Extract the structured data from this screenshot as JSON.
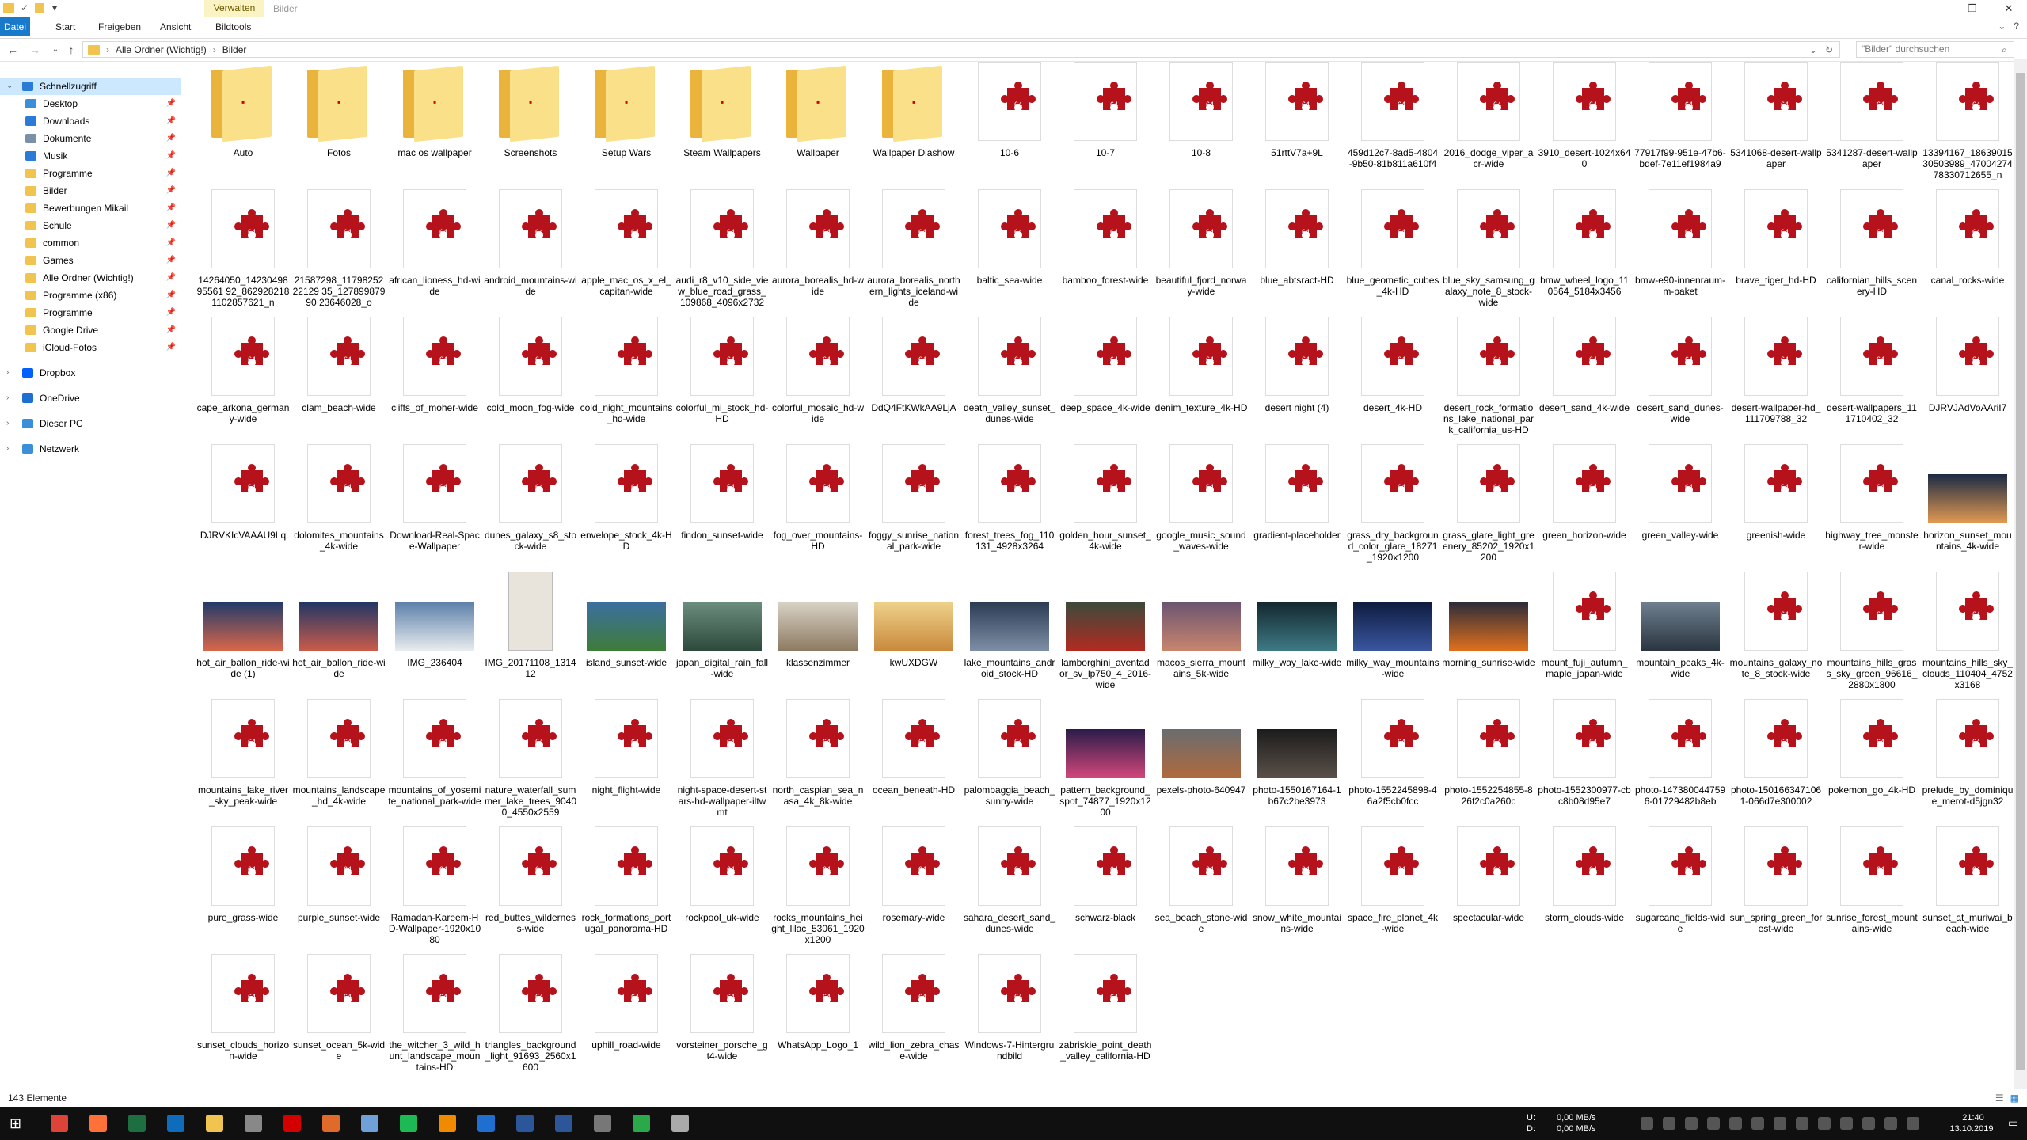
{
  "window": {
    "context_tab": "Verwalten",
    "title": "Bilder"
  },
  "ribbon": {
    "tabs": [
      "Datei",
      "Start",
      "Freigeben",
      "Ansicht",
      "Bildtools"
    ]
  },
  "address": {
    "crumbs": [
      "Alle Ordner (Wichtig!)",
      "Bilder"
    ],
    "search_placeholder": "\"Bilder\" durchsuchen"
  },
  "sidebar": {
    "items": [
      {
        "label": "Schnellzugriff",
        "icon": "star-icon",
        "pinned": false,
        "expand": true
      },
      {
        "label": "Desktop",
        "icon": "desktop-icon",
        "pinned": true
      },
      {
        "label": "Downloads",
        "icon": "download-icon",
        "pinned": true
      },
      {
        "label": "Dokumente",
        "icon": "documents-icon",
        "pinned": true
      },
      {
        "label": "Musik",
        "icon": "music-icon",
        "pinned": true
      },
      {
        "label": "Programme",
        "icon": "folder-icon",
        "pinned": true
      },
      {
        "label": "Bilder",
        "icon": "folder-icon",
        "pinned": true
      },
      {
        "label": "Bewerbungen Mikail",
        "icon": "folder-icon",
        "pinned": true
      },
      {
        "label": "Schule",
        "icon": "folder-icon",
        "pinned": true
      },
      {
        "label": "common",
        "icon": "folder-icon",
        "pinned": true
      },
      {
        "label": "Games",
        "icon": "folder-icon",
        "pinned": true
      },
      {
        "label": "Alle Ordner (Wichtig!)",
        "icon": "folder-icon",
        "pinned": true
      },
      {
        "label": "Programme (x86)",
        "icon": "folder-icon",
        "pinned": true
      },
      {
        "label": "Programme",
        "icon": "folder-icon",
        "pinned": true
      },
      {
        "label": "Google Drive",
        "icon": "folder-icon",
        "pinned": true
      },
      {
        "label": "iCloud-Fotos",
        "icon": "folder-icon",
        "pinned": true
      },
      {
        "label": "Dropbox",
        "icon": "dropbox-icon",
        "pinned": false,
        "expand": true
      },
      {
        "label": "OneDrive",
        "icon": "cloud-icon",
        "pinned": false,
        "expand": true
      },
      {
        "label": "Dieser PC",
        "icon": "pc-icon",
        "pinned": false,
        "expand": true
      },
      {
        "label": "Netzwerk",
        "icon": "network-icon",
        "pinned": false,
        "expand": true
      }
    ]
  },
  "files": [
    {
      "name": "Auto",
      "kind": "folder"
    },
    {
      "name": "Fotos",
      "kind": "folder"
    },
    {
      "name": "mac os wallpaper",
      "kind": "folder"
    },
    {
      "name": "Screenshots",
      "kind": "folder"
    },
    {
      "name": "Setup Wars",
      "kind": "folder"
    },
    {
      "name": "Steam Wallpapers",
      "kind": "folder"
    },
    {
      "name": "Wallpaper",
      "kind": "folder"
    },
    {
      "name": "Wallpaper Diashow",
      "kind": "folder"
    },
    {
      "name": "10-6",
      "kind": "puzzle"
    },
    {
      "name": "10-7",
      "kind": "puzzle"
    },
    {
      "name": "10-8",
      "kind": "puzzle"
    },
    {
      "name": "51rttV7a+9L",
      "kind": "puzzle"
    },
    {
      "name": "459d12c7-8ad5-4804-9b50-81b811a610f4",
      "kind": "puzzle"
    },
    {
      "name": "2016_dodge_viper_acr-wide",
      "kind": "puzzle"
    },
    {
      "name": "3910_desert-1024x640",
      "kind": "puzzle"
    },
    {
      "name": "77917f99-951e-47b6-bdef-7e11ef1984a9",
      "kind": "puzzle"
    },
    {
      "name": "5341068-desert-wallpaper",
      "kind": "puzzle"
    },
    {
      "name": "5341287-desert-wallpaper",
      "kind": "puzzle"
    },
    {
      "name": "13394167_1863901530503989_4700427478330712655_n",
      "kind": "puzzle"
    },
    {
      "name": "14264050_1423049895561 92_862928218 1102857621_n",
      "kind": "puzzle"
    },
    {
      "name": "21587298_1179825222129 35_12789987990 23646028_o",
      "kind": "puzzle"
    },
    {
      "name": "african_lioness_hd-wide",
      "kind": "puzzle"
    },
    {
      "name": "android_mountains-wide",
      "kind": "puzzle"
    },
    {
      "name": "apple_mac_os_x_el_capitan-wide",
      "kind": "puzzle"
    },
    {
      "name": "audi_r8_v10_side_view_blue_road_grass_109868_4096x2732",
      "kind": "puzzle"
    },
    {
      "name": "aurora_borealis_hd-wide",
      "kind": "puzzle"
    },
    {
      "name": "aurora_borealis_northern_lights_iceland-wide",
      "kind": "puzzle"
    },
    {
      "name": "baltic_sea-wide",
      "kind": "puzzle"
    },
    {
      "name": "bamboo_forest-wide",
      "kind": "puzzle"
    },
    {
      "name": "beautiful_fjord_norway-wide",
      "kind": "puzzle"
    },
    {
      "name": "blue_abtsract-HD",
      "kind": "puzzle"
    },
    {
      "name": "blue_geometic_cubes_4k-HD",
      "kind": "puzzle"
    },
    {
      "name": "blue_sky_samsung_galaxy_note_8_stock-wide",
      "kind": "puzzle"
    },
    {
      "name": "bmw_wheel_logo_110564_5184x3456",
      "kind": "puzzle"
    },
    {
      "name": "bmw-e90-innenraum-m-paket",
      "kind": "puzzle"
    },
    {
      "name": "brave_tiger_hd-HD",
      "kind": "puzzle"
    },
    {
      "name": "californian_hills_scenery-HD",
      "kind": "puzzle"
    },
    {
      "name": "canal_rocks-wide",
      "kind": "puzzle"
    },
    {
      "name": "cape_arkona_germany-wide",
      "kind": "puzzle"
    },
    {
      "name": "clam_beach-wide",
      "kind": "puzzle"
    },
    {
      "name": "cliffs_of_moher-wide",
      "kind": "puzzle"
    },
    {
      "name": "cold_moon_fog-wide",
      "kind": "puzzle"
    },
    {
      "name": "cold_night_mountains_hd-wide",
      "kind": "puzzle"
    },
    {
      "name": "colorful_mi_stock_hd-HD",
      "kind": "puzzle"
    },
    {
      "name": "colorful_mosaic_hd-wide",
      "kind": "puzzle"
    },
    {
      "name": "DdQ4FtKWkAA9LjA",
      "kind": "puzzle"
    },
    {
      "name": "death_valley_sunset_dunes-wide",
      "kind": "puzzle"
    },
    {
      "name": "deep_space_4k-wide",
      "kind": "puzzle"
    },
    {
      "name": "denim_texture_4k-HD",
      "kind": "puzzle"
    },
    {
      "name": "desert night (4)",
      "kind": "puzzle"
    },
    {
      "name": "desert_4k-HD",
      "kind": "puzzle"
    },
    {
      "name": "desert_rock_formations_lake_national_park_california_us-HD",
      "kind": "puzzle"
    },
    {
      "name": "desert_sand_4k-wide",
      "kind": "puzzle"
    },
    {
      "name": "desert_sand_dunes-wide",
      "kind": "puzzle"
    },
    {
      "name": "desert-wallpaper-hd_111709788_32",
      "kind": "puzzle"
    },
    {
      "name": "desert-wallpapers_111710402_32",
      "kind": "puzzle"
    },
    {
      "name": "DJRVJAdVoAAriI7",
      "kind": "puzzle"
    },
    {
      "name": "DJRVKIcVAAAU9Lq",
      "kind": "puzzle"
    },
    {
      "name": "dolomites_mountains_4k-wide",
      "kind": "puzzle"
    },
    {
      "name": "Download-Real-Space-Wallpaper",
      "kind": "puzzle"
    },
    {
      "name": "dunes_galaxy_s8_stock-wide",
      "kind": "puzzle"
    },
    {
      "name": "envelope_stock_4k-HD",
      "kind": "puzzle"
    },
    {
      "name": "findon_sunset-wide",
      "kind": "puzzle"
    },
    {
      "name": "fog_over_mountains-HD",
      "kind": "puzzle"
    },
    {
      "name": "foggy_sunrise_national_park-wide",
      "kind": "puzzle"
    },
    {
      "name": "forest_trees_fog_110131_4928x3264",
      "kind": "puzzle"
    },
    {
      "name": "golden_hour_sunset_4k-wide",
      "kind": "puzzle"
    },
    {
      "name": "google_music_sound_waves-wide",
      "kind": "puzzle"
    },
    {
      "name": "gradient-placeholder",
      "kind": "puzzle"
    },
    {
      "name": "grass_dry_background_color_glare_18271_1920x1200",
      "kind": "puzzle"
    },
    {
      "name": "grass_glare_light_greenery_85202_1920x1200",
      "kind": "puzzle"
    },
    {
      "name": "green_horizon-wide",
      "kind": "puzzle"
    },
    {
      "name": "green_valley-wide",
      "kind": "puzzle"
    },
    {
      "name": "greenish-wide",
      "kind": "puzzle"
    },
    {
      "name": "highway_tree_monster-wide",
      "kind": "puzzle"
    },
    {
      "name": "horizon_sunset_mountains_4k-wide",
      "kind": "photo",
      "c1": "#1b2a44",
      "c2": "#e39a52"
    },
    {
      "name": "hot_air_ballon_ride-wide (1)",
      "kind": "photo",
      "c1": "#203a6b",
      "c2": "#d8674a"
    },
    {
      "name": "hot_air_ballon_ride-wide",
      "kind": "photo",
      "c1": "#1f3566",
      "c2": "#c95c4a"
    },
    {
      "name": "IMG_236404",
      "kind": "photo",
      "c1": "#5b7fa9",
      "c2": "#e9ecef"
    },
    {
      "name": "IMG_20171108_131412",
      "kind": "paper"
    },
    {
      "name": "island_sunset-wide",
      "kind": "photo",
      "c1": "#3c6fa0",
      "c2": "#3e7c3a"
    },
    {
      "name": "japan_digital_rain_fall-wide",
      "kind": "photo",
      "c1": "#6c8e7f",
      "c2": "#2d4a3c"
    },
    {
      "name": "klassenzimmer",
      "kind": "photo",
      "c1": "#d9d3c6",
      "c2": "#8d7a62"
    },
    {
      "name": "kwUXDGW",
      "kind": "photo",
      "c1": "#eed28a",
      "c2": "#c98a3d"
    },
    {
      "name": "lake_mountains_android_stock-HD",
      "kind": "photo",
      "c1": "#2b3b52",
      "c2": "#7d8ea6"
    },
    {
      "name": "lamborghini_aventador_sv_lp750_4_2016-wide",
      "kind": "photo",
      "c1": "#3a4a3c",
      "c2": "#b22b22"
    },
    {
      "name": "macos_sierra_mountains_5k-wide",
      "kind": "photo",
      "c1": "#6b5470",
      "c2": "#c8856e"
    },
    {
      "name": "milky_way_lake-wide",
      "kind": "photo",
      "c1": "#13262e",
      "c2": "#3e7a84"
    },
    {
      "name": "milky_way_mountains-wide",
      "kind": "photo",
      "c1": "#0d1b3d",
      "c2": "#3a56a0"
    },
    {
      "name": "morning_sunrise-wide",
      "kind": "photo",
      "c1": "#2b2b3a",
      "c2": "#e0701e"
    },
    {
      "name": "mount_fuji_autumn_maple_japan-wide",
      "kind": "puzzle"
    },
    {
      "name": "mountain_peaks_4k-wide",
      "kind": "photo",
      "c1": "#6f8090",
      "c2": "#2a3540"
    },
    {
      "name": "mountains_galaxy_note_8_stock-wide",
      "kind": "puzzle"
    },
    {
      "name": "mountains_hills_grass_sky_green_96616_2880x1800",
      "kind": "puzzle"
    },
    {
      "name": "mountains_hills_sky_clouds_110404_4752x3168",
      "kind": "puzzle"
    },
    {
      "name": "mountains_lake_river_sky_peak-wide",
      "kind": "puzzle"
    },
    {
      "name": "mountains_landscape_hd_4k-wide",
      "kind": "puzzle"
    },
    {
      "name": "mountains_of_yosemite_national_park-wide",
      "kind": "puzzle"
    },
    {
      "name": "nature_waterfall_summer_lake_trees_90400_4550x2559",
      "kind": "puzzle"
    },
    {
      "name": "night_flight-wide",
      "kind": "puzzle"
    },
    {
      "name": "night-space-desert-stars-hd-wallpaper-iltwmt",
      "kind": "puzzle"
    },
    {
      "name": "north_caspian_sea_nasa_4k_8k-wide",
      "kind": "puzzle"
    },
    {
      "name": "ocean_beneath-HD",
      "kind": "puzzle"
    },
    {
      "name": "palombaggia_beach_sunny-wide",
      "kind": "puzzle"
    },
    {
      "name": "pattern_background_spot_74877_1920x1200",
      "kind": "photo",
      "c1": "#2a1c4a",
      "c2": "#d2477a"
    },
    {
      "name": "pexels-photo-640947",
      "kind": "photo",
      "c1": "#6a6c70",
      "c2": "#b06a3c"
    },
    {
      "name": "photo-1550167164-1b67c2be3973",
      "kind": "photo",
      "c1": "#1c1c1c",
      "c2": "#5a5048"
    },
    {
      "name": "photo-1552245898-46a2f5cb0fcc",
      "kind": "puzzle"
    },
    {
      "name": "photo-1552254855-826f2c0a260c",
      "kind": "puzzle"
    },
    {
      "name": "photo-1552300977-cbc8b08d95e7",
      "kind": "puzzle"
    },
    {
      "name": "photo-1473800447596-01729482b8eb",
      "kind": "puzzle"
    },
    {
      "name": "photo-1501663471061-066d7e300002",
      "kind": "puzzle"
    },
    {
      "name": "pokemon_go_4k-HD",
      "kind": "puzzle"
    },
    {
      "name": "prelude_by_dominique_merot-d5jgn32",
      "kind": "puzzle"
    },
    {
      "name": "pure_grass-wide",
      "kind": "puzzle"
    },
    {
      "name": "purple_sunset-wide",
      "kind": "puzzle"
    },
    {
      "name": "Ramadan-Kareem-HD-Wallpaper-1920x1080",
      "kind": "puzzle"
    },
    {
      "name": "red_buttes_wilderness-wide",
      "kind": "puzzle"
    },
    {
      "name": "rock_formations_portugal_panorama-HD",
      "kind": "puzzle"
    },
    {
      "name": "rockpool_uk-wide",
      "kind": "puzzle"
    },
    {
      "name": "rocks_mountains_height_lilac_53061_1920x1200",
      "kind": "puzzle"
    },
    {
      "name": "rosemary-wide",
      "kind": "puzzle"
    },
    {
      "name": "sahara_desert_sand_dunes-wide",
      "kind": "puzzle"
    },
    {
      "name": "schwarz-black",
      "kind": "puzzle"
    },
    {
      "name": "sea_beach_stone-wide",
      "kind": "puzzle"
    },
    {
      "name": "snow_white_mountains-wide",
      "kind": "puzzle"
    },
    {
      "name": "space_fire_planet_4k-wide",
      "kind": "puzzle"
    },
    {
      "name": "spectacular-wide",
      "kind": "puzzle"
    },
    {
      "name": "storm_clouds-wide",
      "kind": "puzzle"
    },
    {
      "name": "sugarcane_fields-wide",
      "kind": "puzzle"
    },
    {
      "name": "sun_spring_green_forest-wide",
      "kind": "puzzle"
    },
    {
      "name": "sunrise_forest_mountains-wide",
      "kind": "puzzle"
    },
    {
      "name": "sunset_at_muriwai_beach-wide",
      "kind": "puzzle"
    },
    {
      "name": "sunset_clouds_horizon-wide",
      "kind": "puzzle"
    },
    {
      "name": "sunset_ocean_5k-wide",
      "kind": "puzzle"
    },
    {
      "name": "the_witcher_3_wild_hunt_landscape_mountains-HD",
      "kind": "puzzle"
    },
    {
      "name": "triangles_background_light_91693_2560x1600",
      "kind": "puzzle"
    },
    {
      "name": "uphill_road-wide",
      "kind": "puzzle"
    },
    {
      "name": "vorsteiner_porsche_gt4-wide",
      "kind": "puzzle"
    },
    {
      "name": "WhatsApp_Logo_1",
      "kind": "puzzle"
    },
    {
      "name": "wild_lion_zebra_chase-wide",
      "kind": "puzzle"
    },
    {
      "name": "Windows-7-Hintergrundbild",
      "kind": "puzzle"
    },
    {
      "name": "zabriskie_point_death_valley_california-HD",
      "kind": "puzzle"
    }
  ],
  "status": {
    "count": "143 Elemente"
  },
  "tray": {
    "net_label_up": "U:",
    "net_label_down": "D:",
    "net_up": "0,00 MB/s",
    "net_down": "0,00 MB/s",
    "time": "21:40",
    "date": "13.10.2019"
  },
  "colors": {
    "accent": "#1979ca",
    "puzzle": "#b5121b",
    "folder": "#fbe08a",
    "selection": "#cce8ff",
    "taskbar": "#101010"
  }
}
